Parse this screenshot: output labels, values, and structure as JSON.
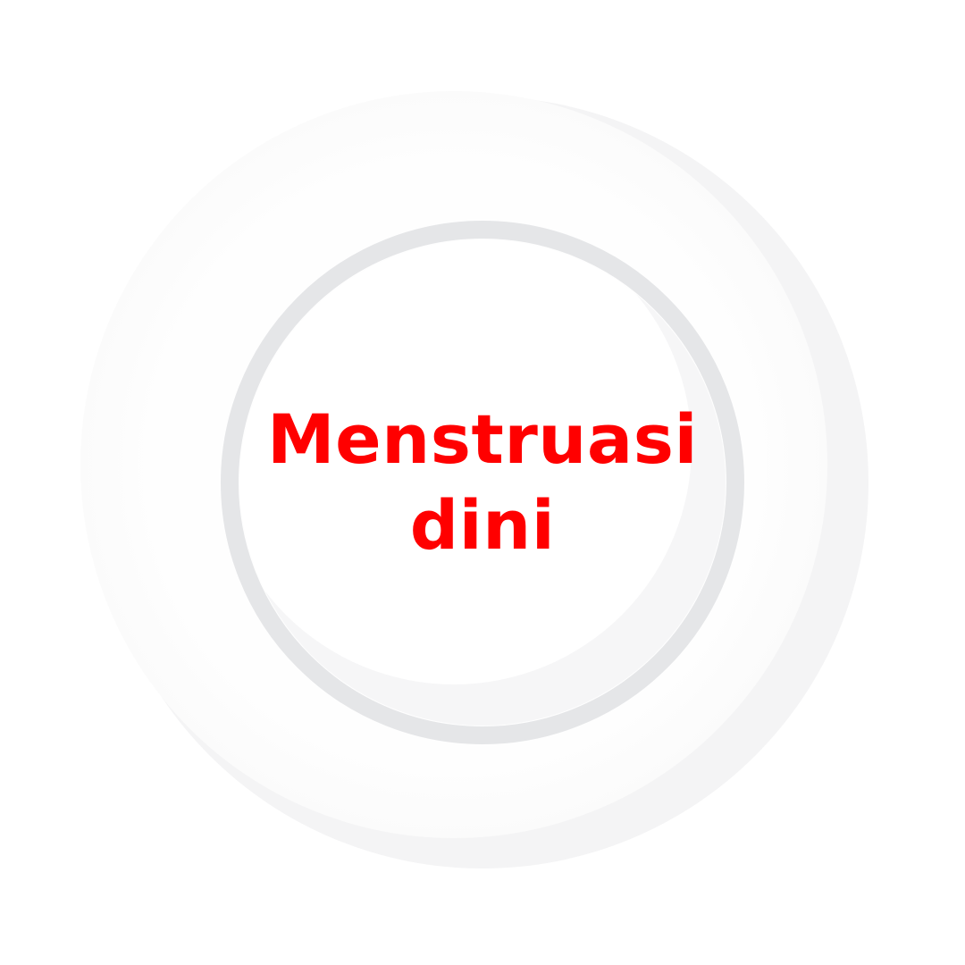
{
  "label": {
    "line1": "Menstruasi",
    "line2": "dini"
  },
  "colors": {
    "text": "#ff0000",
    "background": "#ffffff",
    "outer_disc": "#fdfdfd",
    "outer_shadow": "#f4f4f5",
    "inner_ring": "#e5e6e8",
    "inner_disc": "#ffffff",
    "inner_shadow": "#f6f6f7"
  }
}
